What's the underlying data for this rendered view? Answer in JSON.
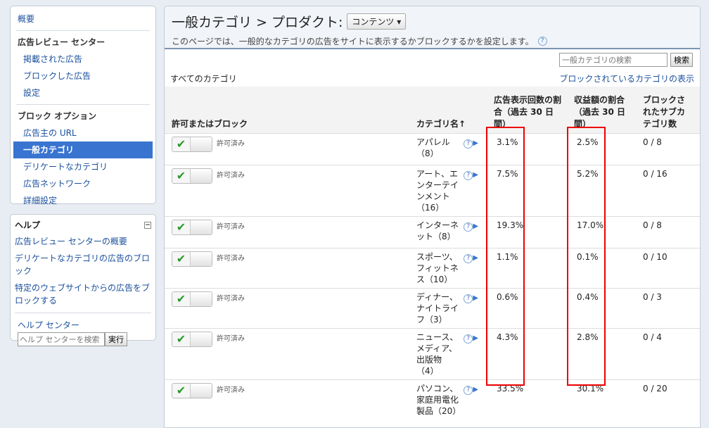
{
  "nav": {
    "overview": "概要",
    "review_center_head": "広告レビュー センター",
    "items_review": [
      "掲載された広告",
      "ブロックした広告",
      "設定"
    ],
    "block_options_head": "ブロック オプション",
    "items_block": [
      "広告主の URL",
      "一般カテゴリ",
      "デリケートなカテゴリ",
      "広告ネットワーク",
      "詳細設定"
    ]
  },
  "help": {
    "title": "ヘルプ",
    "links": [
      "広告レビュー センターの概要",
      "デリケートなカテゴリの広告のブロック",
      "特定のウェブサイトからの広告をブロックする"
    ],
    "center": "ヘルプ センター",
    "search_placeholder": "ヘルプ センターを検索",
    "go": "実行"
  },
  "header": {
    "title": "一般カテゴリ > プロダクト:",
    "dropdown": "コンテンツ",
    "description": "このページでは、一般的なカテゴリの広告をサイトに表示するかブロックするかを設定します。"
  },
  "toolbar": {
    "search_placeholder": "一般カテゴリの検索",
    "search_button": "検索"
  },
  "all_categories": "すべてのカテゴリ",
  "show_blocked": "ブロックされているカテゴリの表示",
  "columns": {
    "allow": "許可またはブロック",
    "category": "カテゴリ名",
    "sort": "↑",
    "impr": "広告表示回数の割合（過去 30 日間）",
    "rev": "収益額の割合（過去 30 日間）",
    "sub": "ブロックされたサブカテゴリ数"
  },
  "rows": [
    {
      "status": "許可済み",
      "category": "アパレル（8）",
      "impr": "3.1%",
      "rev": "2.5%",
      "sub": "0 / 8"
    },
    {
      "status": "許可済み",
      "category": "アート、エンターテインメント（16）",
      "impr": "7.5%",
      "rev": "5.2%",
      "sub": "0 / 16"
    },
    {
      "status": "許可済み",
      "category": "インターネット（8）",
      "impr": "19.3%",
      "rev": "17.0%",
      "sub": "0 / 8"
    },
    {
      "status": "許可済み",
      "category": "スポーツ、フィットネス（10）",
      "impr": "1.1%",
      "rev": "0.1%",
      "sub": "0 / 10"
    },
    {
      "status": "許可済み",
      "category": "ディナー、ナイトライフ（3）",
      "impr": "0.6%",
      "rev": "0.4%",
      "sub": "0 / 3"
    },
    {
      "status": "許可済み",
      "category": "ニュース、メディア、出版物（4）",
      "impr": "4.3%",
      "rev": "2.8%",
      "sub": "0 / 4"
    },
    {
      "status": "許可済み",
      "category": "パソコン、家庭用電化製品（20）",
      "impr": "33.5%",
      "rev": "30.1%",
      "sub": "0 / 20"
    }
  ],
  "icons": {
    "check": "✔",
    "help": "?",
    "arrow": "▶"
  }
}
